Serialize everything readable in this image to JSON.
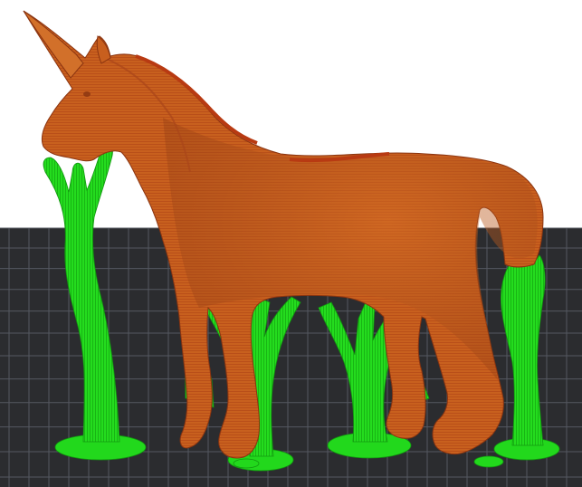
{
  "viewport": {
    "view": "slice-preview",
    "model": "unicorn",
    "layers": [
      "model-walls",
      "tree-supports"
    ],
    "colors": {
      "background": "#ffffff",
      "build_plate": "#2b2c2f",
      "grid_line": "#555861",
      "model": "#c85f1e",
      "model_shade": "#a9461a",
      "model_top": "#b83a12",
      "support": "#22d81c",
      "support_shade": "#13a010"
    }
  }
}
